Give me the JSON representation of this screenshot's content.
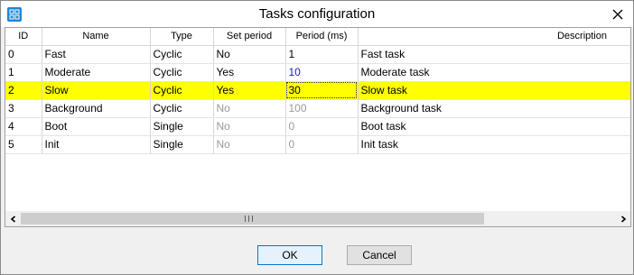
{
  "window": {
    "title": "Tasks configuration",
    "icon": "app-config-icon",
    "close_icon": "close-icon"
  },
  "table": {
    "columns": [
      "ID",
      "Name",
      "Type",
      "Set period",
      "Period (ms)",
      "Description"
    ],
    "rows": [
      {
        "id": "0",
        "name": "Fast",
        "type": "Cyclic",
        "set_period": "No",
        "period": "1",
        "description": "Fast task"
      },
      {
        "id": "1",
        "name": "Moderate",
        "type": "Cyclic",
        "set_period": "Yes",
        "period": "10",
        "description": "Moderate task"
      },
      {
        "id": "2",
        "name": "Slow",
        "type": "Cyclic",
        "set_period": "Yes",
        "period": "30",
        "description": "Slow task"
      },
      {
        "id": "3",
        "name": "Background",
        "type": "Cyclic",
        "set_period": "No",
        "period": "100",
        "description": "Background task"
      },
      {
        "id": "4",
        "name": "Boot",
        "type": "Single",
        "set_period": "No",
        "period": "0",
        "description": "Boot task"
      },
      {
        "id": "5",
        "name": "Init",
        "type": "Single",
        "set_period": "No",
        "period": "0",
        "description": "Init task"
      }
    ],
    "selected_row": 2,
    "highlight_color": "#ffff00"
  },
  "buttons": {
    "ok_label": "OK",
    "cancel_label": "Cancel"
  }
}
